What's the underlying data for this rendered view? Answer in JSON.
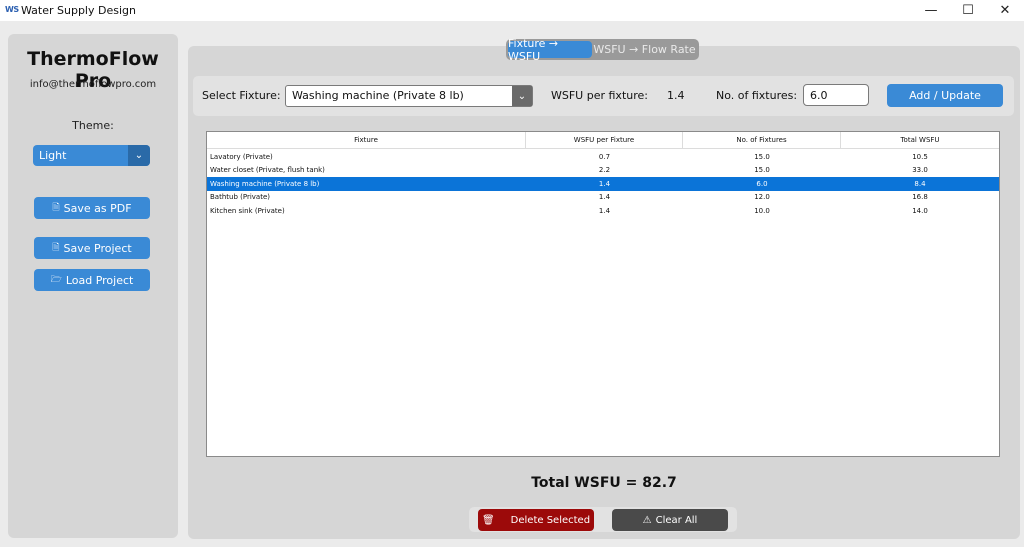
{
  "window": {
    "icon_text": "WS",
    "title": "Water Supply Design",
    "minimize": "—",
    "maximize": "☐",
    "close": "✕"
  },
  "sidebar": {
    "brand": "ThermoFlow Pro",
    "email": "info@thermoflowpro.com",
    "theme_label": "Theme:",
    "theme_value": "Light",
    "save_pdf": "Save as PDF",
    "save_project": "Save Project",
    "load_project": "Load Project"
  },
  "tabs": {
    "active": "Fixture → WSFU",
    "inactive": "WSFU → Flow Rate"
  },
  "fixture_bar": {
    "select_label": "Select Fixture:",
    "selected_fixture": "Washing machine (Private 8 lb)",
    "wsfu_label": "WSFU per fixture:",
    "wsfu_value": "1.4",
    "count_label": "No. of fixtures:",
    "count_value": "6.0",
    "add_label": "Add / Update"
  },
  "table": {
    "headers": [
      "Fixture",
      "WSFU per Fixture",
      "No. of Fixtures",
      "Total WSFU"
    ],
    "rows": [
      [
        "Lavatory (Private)",
        "0.7",
        "15.0",
        "10.5"
      ],
      [
        "Water closet (Private, flush tank)",
        "2.2",
        "15.0",
        "33.0"
      ],
      [
        "Washing machine (Private 8 lb)",
        "1.4",
        "6.0",
        "8.4"
      ],
      [
        "Bathtub (Private)",
        "1.4",
        "12.0",
        "16.8"
      ],
      [
        "Kitchen sink (Private)",
        "1.4",
        "10.0",
        "14.0"
      ]
    ],
    "selected_row": 2
  },
  "total": "Total WSFU = 82.7",
  "actions": {
    "delete": "Delete Selected",
    "clear": "Clear All"
  },
  "colors": {
    "accent": "#3a8ad6",
    "selection": "#0b74d8",
    "danger": "#9c0a0a",
    "dark": "#4a4a4a"
  }
}
